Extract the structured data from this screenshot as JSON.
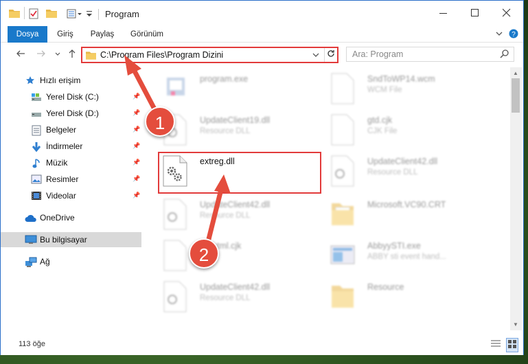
{
  "window": {
    "title": "Program"
  },
  "ribbon": {
    "tabs": [
      {
        "label": "Dosya",
        "active": true
      },
      {
        "label": "Giriş",
        "active": false
      },
      {
        "label": "Paylaş",
        "active": false
      },
      {
        "label": "Görünüm",
        "active": false
      }
    ]
  },
  "address": {
    "path": "C:\\Program Files\\Program Dizini"
  },
  "search": {
    "placeholder": "Ara: Program"
  },
  "sidebar": {
    "items": [
      {
        "label": "Hızlı erişim",
        "icon": "star-icon"
      },
      {
        "label": "Yerel Disk (C:)",
        "icon": "drive-icon",
        "pinned": true
      },
      {
        "label": "Yerel Disk (D:)",
        "icon": "drive-icon",
        "pinned": true
      },
      {
        "label": "Belgeler",
        "icon": "documents-icon",
        "pinned": true
      },
      {
        "label": "İndirmeler",
        "icon": "download-icon",
        "pinned": true
      },
      {
        "label": "Müzik",
        "icon": "music-icon",
        "pinned": true
      },
      {
        "label": "Resimler",
        "icon": "pictures-icon",
        "pinned": true
      },
      {
        "label": "Videolar",
        "icon": "videos-icon",
        "pinned": true
      },
      {
        "label": "OneDrive",
        "icon": "cloud-icon"
      },
      {
        "label": "Bu bilgisayar",
        "icon": "computer-icon",
        "selected": true
      },
      {
        "label": "Ağ",
        "icon": "network-icon"
      }
    ]
  },
  "files": {
    "left": [
      {
        "name": "program.exe",
        "type": ""
      },
      {
        "name": "UpdateClient19.dll",
        "type": "Resource DLL"
      },
      {
        "name": "extreg.dll",
        "type": "",
        "highlighted": true
      },
      {
        "name": "UpdateClient42.dll",
        "type": "Resource DLL"
      },
      {
        "name": "Exthtml.cjk",
        "type": ""
      },
      {
        "name": "UpdateClient42.dll",
        "type": "Resource DLL"
      }
    ],
    "right": [
      {
        "name": "SndToWP14.wcm",
        "type": "WCM File"
      },
      {
        "name": "gtd.cjk",
        "type": "CJK File"
      },
      {
        "name": "UpdateClient42.dll",
        "type": "Resource DLL"
      },
      {
        "name": "Microsoft.VC90.CRT",
        "type": ""
      },
      {
        "name": "AbbyySTI.exe",
        "type": "ABBY sti event hand..."
      },
      {
        "name": "Resource",
        "type": ""
      }
    ]
  },
  "status": {
    "count": "113 öğe"
  },
  "annotations": {
    "step1": "1",
    "step2": "2",
    "color": "#e44d3d"
  }
}
